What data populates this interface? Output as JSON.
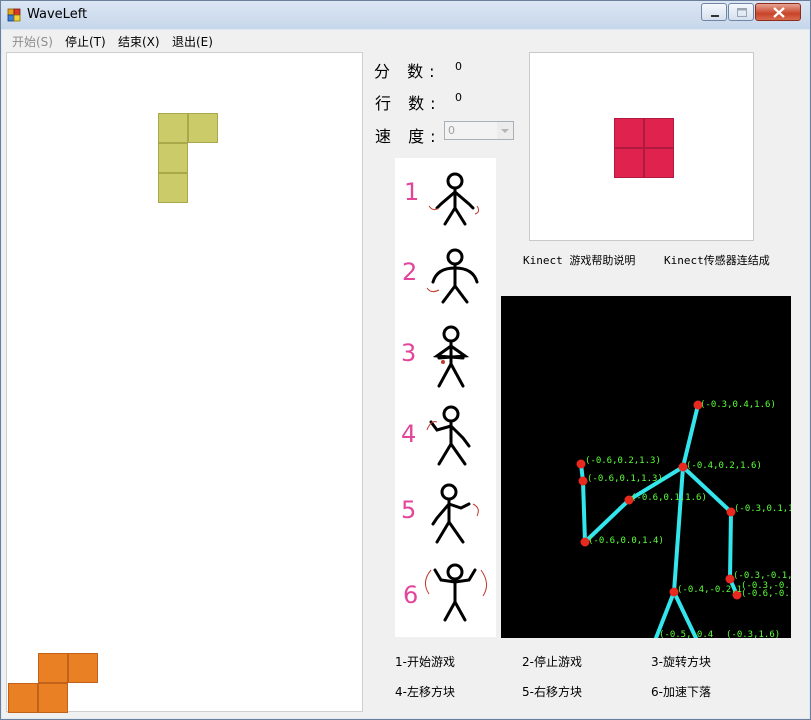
{
  "window": {
    "title": "WaveLeft"
  },
  "menu": [
    {
      "label": "开始(S)",
      "enabled": false
    },
    {
      "label": "停止(T)",
      "enabled": true
    },
    {
      "label": "结束(X)",
      "enabled": true
    },
    {
      "label": "退出(E)",
      "enabled": true
    }
  ],
  "stats": {
    "score_label": "分 数:",
    "score_value": "0",
    "lines_label": "行 数:",
    "lines_value": "0",
    "speed_label": "速 度:",
    "speed_value": "0"
  },
  "links": {
    "help": "Kinect 游戏帮助说明",
    "sensor": "Kinect传感器连结成"
  },
  "gestures": [
    "1",
    "2",
    "3",
    "4",
    "5",
    "6"
  ],
  "skeleton_labels": [
    "(-0.3,0.4,1.6)",
    "(-0.6,0.2,1.3)",
    "(-0.6,0.1,1.3)",
    "(-0.4,0.2,1.6)",
    "(-0.6,0.1,1.6)",
    "(-0.3,0.1,1.",
    "(-0.6,0.0,1.4)",
    "(-0.4,-0.2,1",
    "(-0.3,-0.1,1",
    "(-0.3,-0.1",
    "(-0.6,-0.1",
    "(-0.5,-0.4",
    "(-0.3,1.6)"
  ],
  "help_items": [
    "1-开始游戏",
    "2-停止游戏",
    "3-旋转方块",
    "4-左移方块",
    "5-右移方块",
    "6-加速下落"
  ],
  "colors": {
    "falling_piece": "#cbcb6a",
    "landed_piece": "#e98024",
    "next_piece": "#e0224f",
    "bones": "#33e6ee",
    "joints": "#e8291f",
    "joint_labels": "#5bff3a",
    "gesture_numbers": "#e2459a"
  }
}
